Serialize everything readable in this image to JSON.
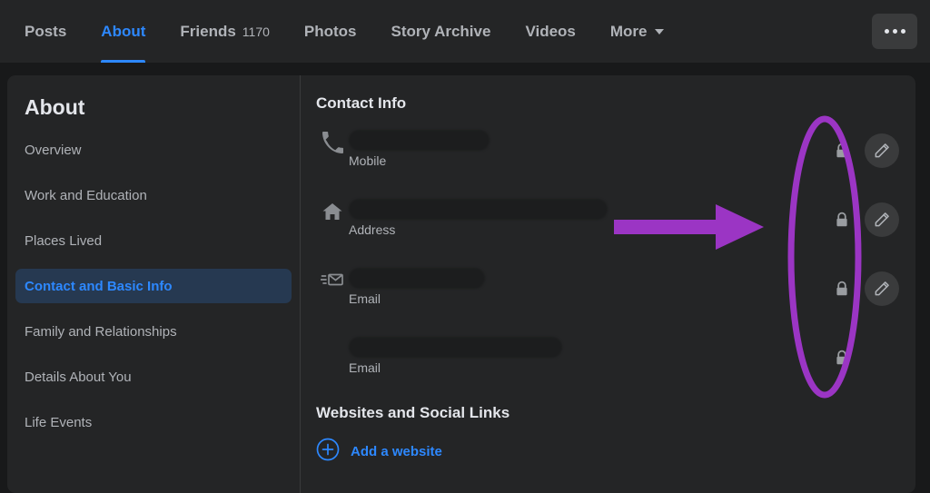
{
  "header": {
    "tabs": [
      {
        "label": "Posts",
        "count": null,
        "active": false,
        "icon": null
      },
      {
        "label": "About",
        "count": null,
        "active": true,
        "icon": null
      },
      {
        "label": "Friends",
        "count": "1170",
        "active": false,
        "icon": null
      },
      {
        "label": "Photos",
        "count": null,
        "active": false,
        "icon": null
      },
      {
        "label": "Story Archive",
        "count": null,
        "active": false,
        "icon": null
      },
      {
        "label": "Videos",
        "count": null,
        "active": false,
        "icon": null
      },
      {
        "label": "More",
        "count": null,
        "active": false,
        "icon": "chevron-down-icon"
      }
    ],
    "more_options_icon": "ellipsis-icon"
  },
  "sidebar": {
    "title": "About",
    "items": [
      {
        "label": "Overview",
        "active": false
      },
      {
        "label": "Work and Education",
        "active": false
      },
      {
        "label": "Places Lived",
        "active": false
      },
      {
        "label": "Contact and Basic Info",
        "active": true
      },
      {
        "label": "Family and Relationships",
        "active": false
      },
      {
        "label": "Details About You",
        "active": false
      },
      {
        "label": "Life Events",
        "active": false
      }
    ]
  },
  "main": {
    "contact_info_title": "Contact Info",
    "rows": [
      {
        "icon": "phone-icon",
        "label": "Mobile",
        "value_redacted": true,
        "redact_width": 155,
        "lock_icon": "lock-icon",
        "edit_icon": "pencil-icon",
        "has_edit": true
      },
      {
        "icon": "home-icon",
        "label": "Address",
        "value_redacted": true,
        "redact_width": 285,
        "lock_icon": "lock-icon",
        "edit_icon": "pencil-icon",
        "has_edit": true
      },
      {
        "icon": "email-send-icon",
        "label": "Email",
        "value_redacted": true,
        "redact_width": 150,
        "lock_icon": "lock-icon",
        "edit_icon": "pencil-icon",
        "has_edit": true
      },
      {
        "icon": null,
        "label": "Email",
        "value_redacted": true,
        "redact_width": 235,
        "lock_icon": "lock-icon",
        "edit_icon": null,
        "has_edit": false
      }
    ],
    "websites_title": "Websites and Social Links",
    "add_website_label": "Add a website",
    "add_website_icon": "plus-circle-icon"
  },
  "annotations": {
    "color": "#9b35c4",
    "arrow": {
      "name": "purple-arrow-annotation"
    },
    "ellipse": {
      "name": "purple-ellipse-annotation"
    }
  },
  "colors": {
    "accent_blue": "#2d88ff",
    "annotation_purple": "#9b35c4",
    "card_bg": "#242526",
    "page_bg": "#18191a",
    "active_item_bg": "#263951"
  }
}
